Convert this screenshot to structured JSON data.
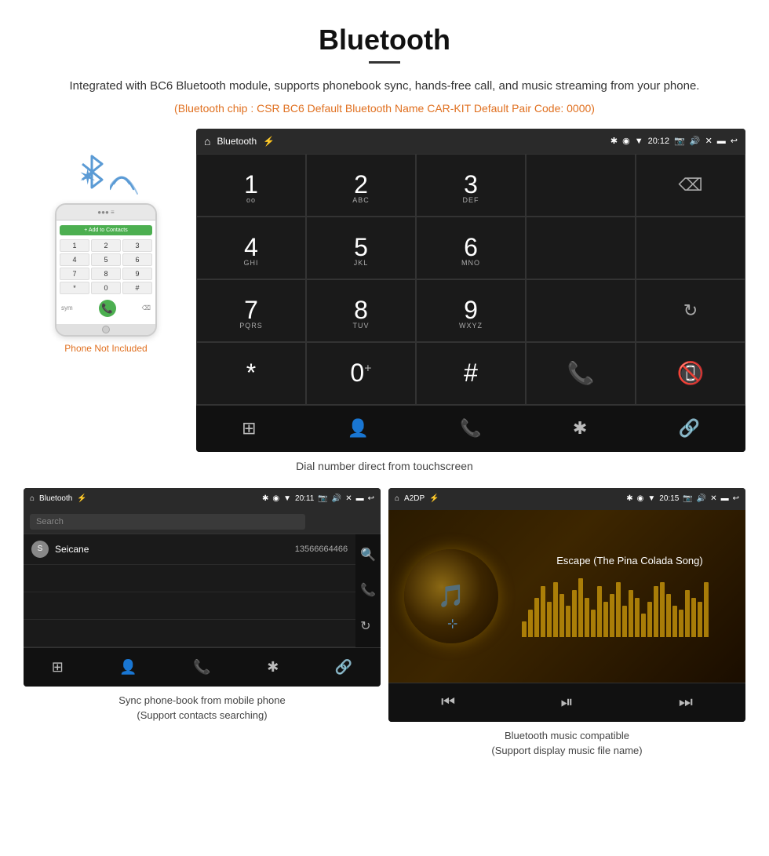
{
  "page": {
    "title": "Bluetooth",
    "subtitle": "Integrated with BC6 Bluetooth module, supports phonebook sync, hands-free call, and music streaming from your phone.",
    "orange_info": "(Bluetooth chip : CSR BC6    Default Bluetooth Name CAR-KIT    Default Pair Code: 0000)",
    "dial_caption": "Dial number direct from touchscreen",
    "phone_not_included": "Phone Not Included",
    "phonebook_caption": "Sync phone-book from mobile phone\n(Support contacts searching)",
    "music_caption": "Bluetooth music compatible\n(Support display music file name)"
  },
  "main_screen": {
    "status_bar": {
      "app_name": "Bluetooth",
      "time": "20:12"
    },
    "dialpad": {
      "keys": [
        {
          "number": "1",
          "letters": ""
        },
        {
          "number": "2",
          "letters": "ABC"
        },
        {
          "number": "3",
          "letters": "DEF"
        },
        {
          "number": "4",
          "letters": "GHI"
        },
        {
          "number": "5",
          "letters": "JKL"
        },
        {
          "number": "6",
          "letters": "MNO"
        },
        {
          "number": "7",
          "letters": "PQRS"
        },
        {
          "number": "8",
          "letters": "TUV"
        },
        {
          "number": "9",
          "letters": "WXYZ"
        },
        {
          "number": "*",
          "letters": ""
        },
        {
          "number": "0",
          "letters": "+"
        },
        {
          "number": "#",
          "letters": ""
        }
      ]
    },
    "nav_icons": [
      "⊞",
      "👤",
      "📞",
      "✱",
      "🔗"
    ]
  },
  "phonebook_screen": {
    "status_bar": {
      "app_name": "Bluetooth",
      "time": "20:11"
    },
    "search_placeholder": "Search",
    "contacts": [
      {
        "initial": "S",
        "name": "Seicane",
        "phone": "13566664466"
      }
    ]
  },
  "music_screen": {
    "status_bar": {
      "app_name": "A2DP",
      "time": "20:15"
    },
    "song_title": "Escape (The Pina Colada Song)"
  },
  "phone_keypad": {
    "rows": [
      [
        "1",
        "2",
        "3"
      ],
      [
        "4",
        "5",
        "6"
      ],
      [
        "7",
        "8",
        "9"
      ],
      [
        "*",
        "0",
        "#"
      ]
    ]
  },
  "eq_heights": [
    20,
    35,
    50,
    65,
    45,
    70,
    55,
    40,
    60,
    75,
    50,
    35,
    65,
    45,
    55,
    70,
    40,
    60,
    50,
    30,
    45,
    65,
    70,
    55,
    40,
    35,
    60,
    50,
    45,
    70
  ]
}
